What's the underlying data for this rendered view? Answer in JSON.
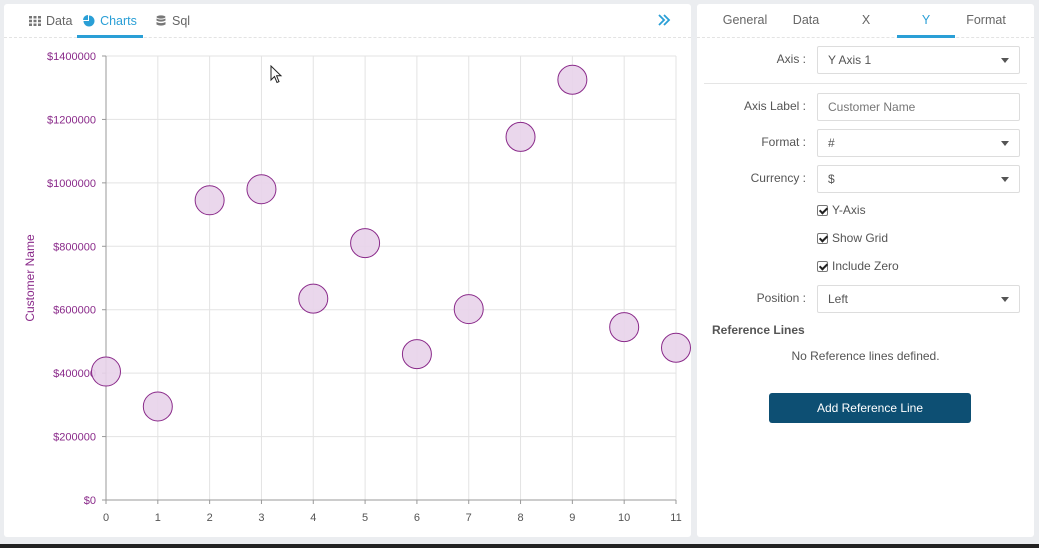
{
  "left_tabs": [
    {
      "label": "Data",
      "icon": "grid-icon"
    },
    {
      "label": "Charts",
      "icon": "pie-chart-icon",
      "active": true
    },
    {
      "label": "Sql",
      "icon": "database-icon"
    }
  ],
  "collapse_icon": "double-chevron-right-icon",
  "right_tabs": [
    {
      "label": "General"
    },
    {
      "label": "Data"
    },
    {
      "label": "X"
    },
    {
      "label": "Y",
      "active": true
    },
    {
      "label": "Format"
    }
  ],
  "form": {
    "axis_label": "Axis :",
    "axis_value": "Y Axis 1",
    "axis_label_label": "Axis Label :",
    "axis_label_placeholder": "Customer Name",
    "format_label": "Format :",
    "format_value": "#",
    "currency_label": "Currency :",
    "currency_value": "$",
    "checkbox_y_axis": "Y-Axis",
    "checkbox_show_grid": "Show Grid",
    "checkbox_include_zero": "Include Zero",
    "position_label": "Position :",
    "position_value": "Left"
  },
  "reference_lines": {
    "title": "Reference Lines",
    "empty_message": "No Reference lines defined.",
    "add_button": "Add Reference Line"
  },
  "colors": {
    "accent": "#2a9fd6",
    "axis_text": "#8a2a8a",
    "bubble_fill": "#e8d3ea",
    "bubble_stroke": "#8a2a8a",
    "primary_button": "#0d4f73"
  },
  "chart_data": {
    "type": "scatter",
    "ylabel": "Customer Name",
    "xlabel": "",
    "x": [
      0,
      1,
      2,
      3,
      4,
      5,
      6,
      7,
      8,
      9,
      10,
      11
    ],
    "y": [
      405000,
      295000,
      945000,
      980000,
      635000,
      810000,
      460000,
      602000,
      1145000,
      1325000,
      545000,
      480000
    ],
    "xlim": [
      0,
      11
    ],
    "ylim": [
      0,
      1400000
    ],
    "x_ticks": [
      "0",
      "1",
      "2",
      "3",
      "4",
      "5",
      "6",
      "7",
      "8",
      "9",
      "10",
      "11"
    ],
    "y_ticks": [
      "$0",
      "$200000",
      "$400000",
      "$600000",
      "$800000",
      "$1000000",
      "$1200000",
      "$1400000"
    ],
    "grid": true
  }
}
